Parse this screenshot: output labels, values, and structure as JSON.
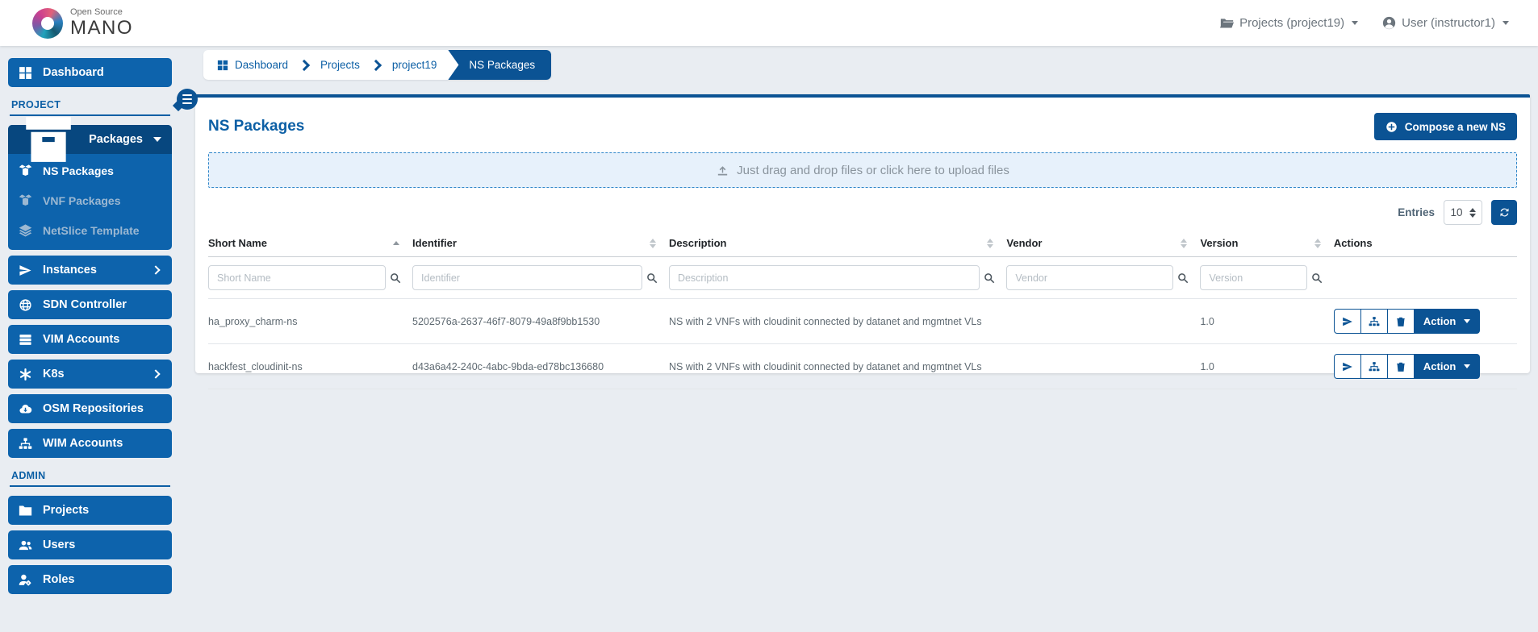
{
  "colors": {
    "primary": "#0b5394",
    "sidebar_item": "#0d63ac",
    "sidebar_active": "#07477f",
    "link_blue": "#0c5fa5",
    "page_background": "#e9edf2",
    "dropzone_background": "#e7f1fb"
  },
  "header": {
    "logo_top": "Open Source",
    "logo_name": "MANO",
    "projects_menu": "Projects (project19)",
    "user_menu": "User (instructor1)"
  },
  "sidebar": {
    "dashboard": "Dashboard",
    "section_project": "PROJECT",
    "packages": "Packages",
    "ns_packages": "NS Packages",
    "vnf_packages": "VNF Packages",
    "netslice_template": "NetSlice Template",
    "instances": "Instances",
    "sdn_controller": "SDN Controller",
    "vim_accounts": "VIM Accounts",
    "k8s": "K8s",
    "osm_repositories": "OSM Repositories",
    "wim_accounts": "WIM Accounts",
    "section_admin": "ADMIN",
    "projects": "Projects",
    "users": "Users",
    "roles": "Roles"
  },
  "breadcrumb": {
    "items": [
      "Dashboard",
      "Projects",
      "project19",
      "NS Packages"
    ]
  },
  "main": {
    "title": "NS Packages",
    "compose_button": "Compose a new NS",
    "upload_hint": "Just drag and drop files or click here to upload files",
    "entries_label": "Entries",
    "entries_value": "10"
  },
  "table": {
    "columns": [
      "Short Name",
      "Identifier",
      "Description",
      "Vendor",
      "Version",
      "Actions"
    ],
    "filters": [
      "Short Name",
      "Identifier",
      "Description",
      "Vendor",
      "Version"
    ],
    "action_button": "Action",
    "rows": [
      {
        "short_name": "ha_proxy_charm-ns",
        "identifier": "5202576a-2637-46f7-8079-49a8f9bb1530",
        "description": "NS with 2 VNFs with cloudinit connected by datanet and mgmtnet VLs",
        "vendor": "",
        "version": "1.0"
      },
      {
        "short_name": "hackfest_cloudinit-ns",
        "identifier": "d43a6a42-240c-4abc-9bda-ed78bc136680",
        "description": "NS with 2 VNFs with cloudinit connected by datanet and mgmtnet VLs",
        "vendor": "",
        "version": "1.0"
      }
    ]
  }
}
